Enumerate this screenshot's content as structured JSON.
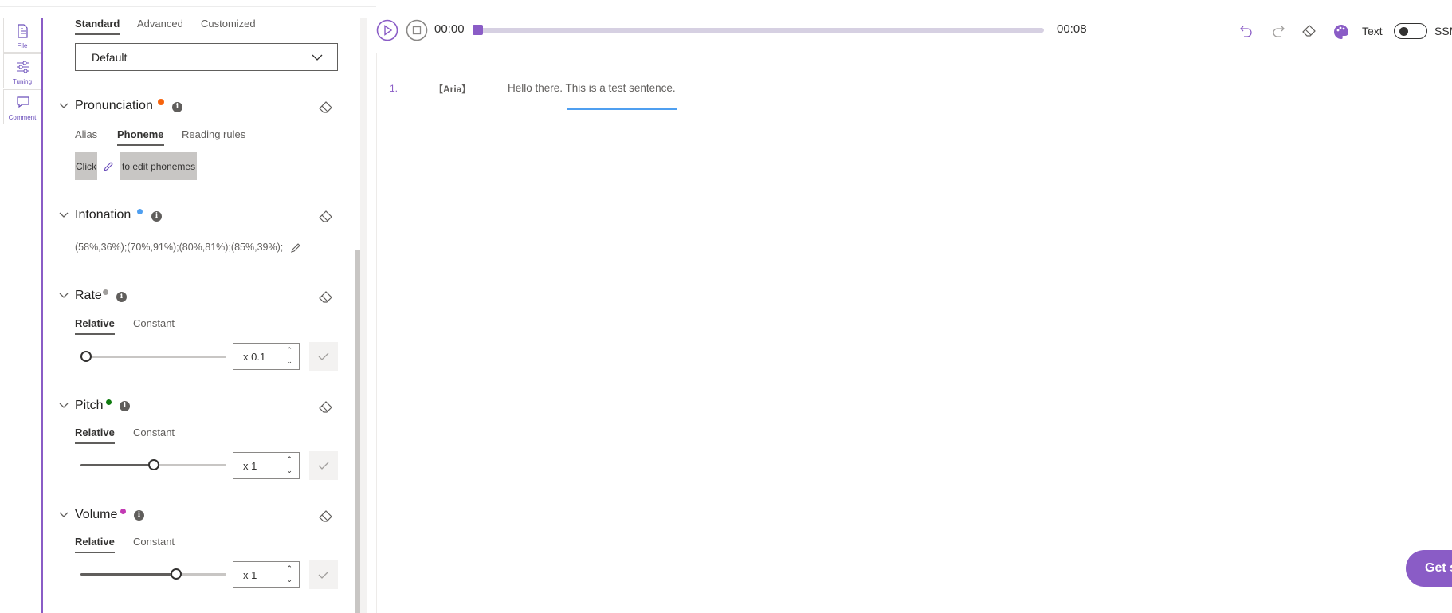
{
  "rail": {
    "items": [
      {
        "label": "File",
        "selected": false
      },
      {
        "label": "Tuning",
        "selected": true
      },
      {
        "label": "Comment",
        "selected": false
      }
    ]
  },
  "panel": {
    "style_tabs": [
      "Standard",
      "Advanced",
      "Customized"
    ],
    "style_tab_selected": "Standard",
    "style_dropdown": {
      "value": "Default"
    },
    "pronunciation": {
      "title": "Pronunciation",
      "dot_color": "#f7630c",
      "tabs": [
        "Alias",
        "Phoneme",
        "Reading rules"
      ],
      "tab_selected": "Phoneme",
      "hint_before": "Click",
      "hint_after": "to edit phonemes"
    },
    "intonation": {
      "title": "Intonation",
      "dot_color": "#4f9ff0",
      "value": "(58%,36%);(70%,91%);(80%,81%);(85%,39%);"
    },
    "rate": {
      "title": "Rate",
      "dot_color": "#a19f9d",
      "tabs": [
        "Relative",
        "Constant"
      ],
      "tab_selected": "Relative",
      "value": "x 0.1",
      "slider_level": 0.0
    },
    "pitch": {
      "title": "Pitch",
      "dot_color": "#107c10",
      "tabs": [
        "Relative",
        "Constant"
      ],
      "tab_selected": "Relative",
      "value": "x 1",
      "slider_level": 0.5
    },
    "volume": {
      "title": "Volume",
      "dot_color": "#c239b3",
      "tabs": [
        "Relative",
        "Constant"
      ],
      "tab_selected": "Relative",
      "value": "x 1",
      "slider_level": 0.67
    }
  },
  "player": {
    "current_time": "00:00",
    "total_time": "00:08",
    "progress": 0.0,
    "accent": "#8a5cc6"
  },
  "toolbar": {
    "icons": [
      "undo-icon",
      "redo-icon",
      "eraser-icon",
      "palette-icon"
    ],
    "text_label": "Text",
    "ssml_label": "SSM"
  },
  "editor": {
    "lines": [
      {
        "number": "1.",
        "voice": "【Aria】",
        "text": "Hello there. This is a test sentence."
      }
    ]
  },
  "cta": {
    "label": "Get s"
  }
}
